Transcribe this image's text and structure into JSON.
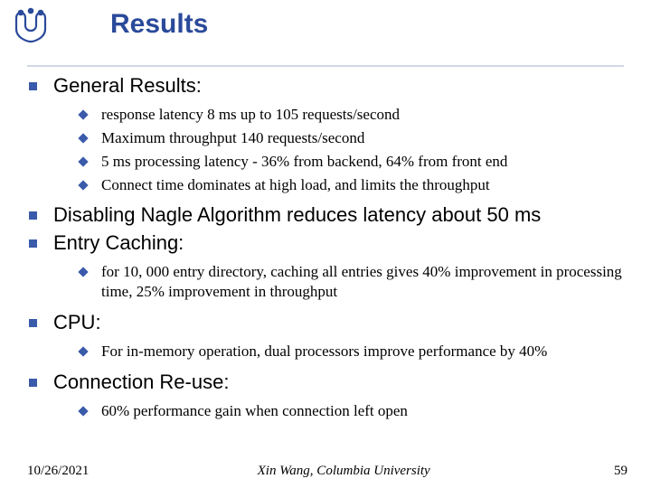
{
  "title": "Results",
  "sections": [
    {
      "heading": "General Results:",
      "items": [
        "response latency 8 ms up to 105 requests/second",
        "Maximum throughput 140 requests/second",
        "5 ms processing latency - 36% from backend, 64% from front end",
        "Connect time dominates at high load, and limits the throughput"
      ]
    },
    {
      "heading": "Disabling Nagle Algorithm reduces latency about 50 ms",
      "items": []
    },
    {
      "heading": "Entry Caching:",
      "items": [
        "for 10, 000 entry directory,  caching all entries gives 40% improvement in processing time, 25% improvement in throughput"
      ]
    },
    {
      "heading": "CPU:",
      "items": [
        "For in-memory operation, dual processors improve performance by 40%"
      ]
    },
    {
      "heading": "Connection Re-use:",
      "items": [
        "60% performance gain when connection left open"
      ]
    }
  ],
  "footer": {
    "date": "10/26/2021",
    "center": "Xin Wang, Columbia University",
    "page": "59"
  }
}
